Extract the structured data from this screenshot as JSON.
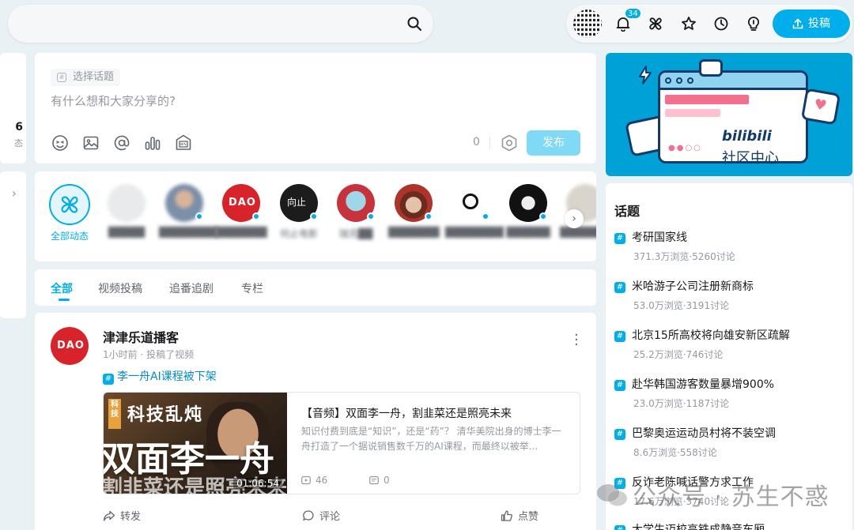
{
  "search": {
    "placeholder": ""
  },
  "header": {
    "notification_count": "34",
    "upload_label": "投稿"
  },
  "left_stub": {
    "count": "6",
    "label": "态",
    "arrow": "›"
  },
  "composer": {
    "topic_chip": "选择话题",
    "placeholder": "有什么想和大家分享的?",
    "char_count": "0",
    "publish_label": "发布",
    "tools": [
      "emoji-icon",
      "image-icon",
      "at-icon",
      "poll-icon",
      "live-icon"
    ]
  },
  "uplist": {
    "all_label": "全部动态",
    "ups": [
      {
        "name": "█████"
      },
      {
        "name": "████████"
      },
      {
        "name": "███████"
      },
      {
        "name": "何止电影"
      },
      {
        "name": "瑞克██"
      },
      {
        "name": "███████"
      },
      {
        "name": "████████"
      },
      {
        "name": "██████"
      },
      {
        "name": "███████"
      }
    ]
  },
  "tabs": [
    "全部",
    "视频投稿",
    "追番追剧",
    "专栏"
  ],
  "post": {
    "author": "津津乐道播客",
    "time": "1小时前",
    "action": "投稿了视频",
    "topic": "李一舟AI课程被下架",
    "video": {
      "title": "【音频】双面李一舟，割韭菜还是照亮未来",
      "desc": "知识付费到底是“知识”，还是“药”？ 清华美院出身的博士李一舟打造了一个据说销售数千万的AI课程，而最终以被举...",
      "plays": "46",
      "comments": "0",
      "duration": "01:06:54",
      "thumb_tag": "科技",
      "thumb_title1": "科技乱炖",
      "thumb_title2": "双面李一舟",
      "thumb_title3": "割韭菜还是照亮未来"
    },
    "actions": {
      "forward": "转发",
      "comment": "评论",
      "like": "点赞"
    }
  },
  "banner": {
    "logo": "bilibili",
    "text": "社区中心"
  },
  "topics": {
    "title": "话题",
    "items": [
      {
        "name": "考研国家线",
        "stats": "371.3万浏览·5260讨论"
      },
      {
        "name": "米哈游子公司注册新商标",
        "stats": "53.0万浏览·3191讨论"
      },
      {
        "name": "北京15所高校将向雄安新区疏解",
        "stats": "25.2万浏览·746讨论"
      },
      {
        "name": "赴华韩国游客数量暴增900%",
        "stats": "23.0万浏览·1187讨论"
      },
      {
        "name": "巴黎奥运运动员村将不装空调",
        "stats": "8.6万浏览·558讨论"
      },
      {
        "name": "反诈老陈喊话警方求工作",
        "stats": "17.6万浏览·3740讨论"
      },
      {
        "name": "大学生迈校高铁成静音车厢",
        "stats": ""
      }
    ]
  },
  "watermark": "公众号 · 苏生不惑"
}
